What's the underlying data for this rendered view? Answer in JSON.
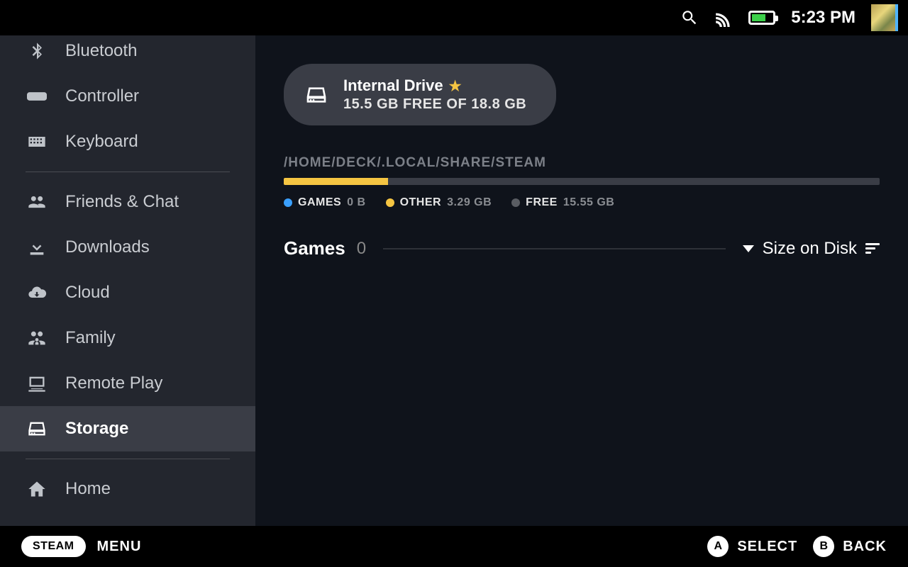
{
  "topbar": {
    "time": "5:23 PM"
  },
  "sidebar": {
    "items": [
      {
        "label": "Bluetooth",
        "slug": "bluetooth",
        "active": false
      },
      {
        "label": "Controller",
        "slug": "controller",
        "active": false
      },
      {
        "label": "Keyboard",
        "slug": "keyboard",
        "active": false
      },
      {
        "divider": true
      },
      {
        "label": "Friends & Chat",
        "slug": "friends-chat",
        "active": false
      },
      {
        "label": "Downloads",
        "slug": "downloads",
        "active": false
      },
      {
        "label": "Cloud",
        "slug": "cloud",
        "active": false
      },
      {
        "label": "Family",
        "slug": "family",
        "active": false
      },
      {
        "label": "Remote Play",
        "slug": "remote-play",
        "active": false
      },
      {
        "label": "Storage",
        "slug": "storage",
        "active": true
      },
      {
        "divider": true
      },
      {
        "label": "Home",
        "slug": "home",
        "active": false
      }
    ]
  },
  "storage": {
    "drive": {
      "title": "Internal Drive",
      "subtitle": "15.5 GB FREE OF 18.8 GB",
      "default": true
    },
    "path": "/HOME/DECK/.LOCAL/SHARE/STEAM",
    "legend": {
      "games": {
        "label": "GAMES",
        "value": "0 B",
        "color": "#3aa0ff"
      },
      "other": {
        "label": "OTHER",
        "value": "3.29 GB",
        "color": "#f5c542"
      },
      "free": {
        "label": "FREE",
        "value": "15.55 GB",
        "color": "#5a5d63"
      }
    },
    "games_header": {
      "title": "Games",
      "count": "0",
      "sort_label": "Size on Disk"
    }
  },
  "footer": {
    "steam": "STEAM",
    "menu": "MENU",
    "hints": {
      "a": "SELECT",
      "b": "BACK"
    }
  }
}
